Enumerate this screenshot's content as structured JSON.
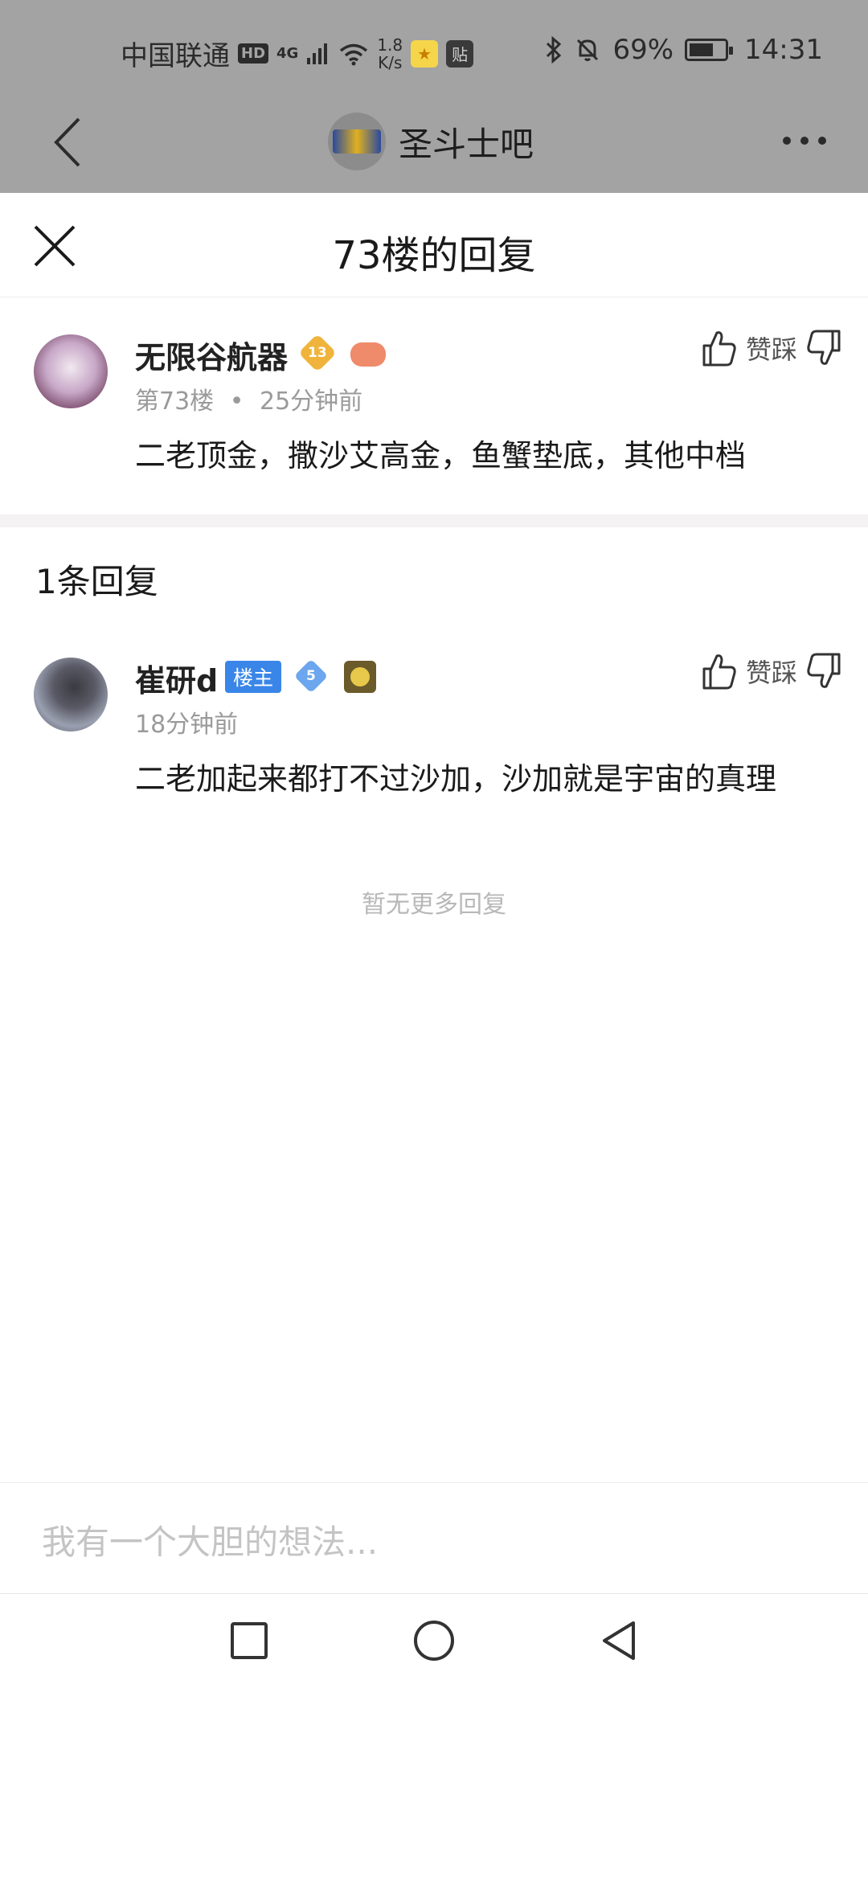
{
  "status_bar": {
    "carrier": "中国联通",
    "hd": "HD",
    "network": "4G",
    "net_speed_value": "1.8",
    "net_speed_unit": "K/s",
    "battery_percent": "69%",
    "battery_level": 0.69,
    "time": "14:31",
    "icons": [
      "hd-icon",
      "signal-icon",
      "wifi-icon",
      "star-app-icon",
      "tieba-app-icon",
      "bluetooth-icon",
      "mute-bell-icon",
      "battery-icon"
    ]
  },
  "nav": {
    "forum_title": "圣斗士吧",
    "icons": [
      "back-arrow-icon",
      "more-dots-icon"
    ]
  },
  "sheet": {
    "title": "73楼的回复",
    "close_icon": "close-icon"
  },
  "main_post": {
    "username": "无限谷航器",
    "level": "13",
    "floor": "第73楼",
    "separator": "•",
    "time": "25分钟前",
    "vote_label": "赞踩",
    "content": "二老顶金，撒沙艾高金，鱼蟹垫底，其他中档"
  },
  "replies": {
    "count_label": "1条回复",
    "items": [
      {
        "username": "崔研d",
        "host_badge": "楼主",
        "level": "5",
        "time": "18分钟前",
        "vote_label": "赞踩",
        "content": "二老加起来都打不过沙加，沙加就是宇宙的真理"
      }
    ],
    "no_more": "暂无更多回复"
  },
  "input": {
    "placeholder": "我有一个大胆的想法..."
  },
  "colors": {
    "dim_overlay": "#a3a3a3",
    "host_badge": "#3a86e8",
    "gold_level": "#f0b43c",
    "blue_level": "#6ba6ee"
  }
}
